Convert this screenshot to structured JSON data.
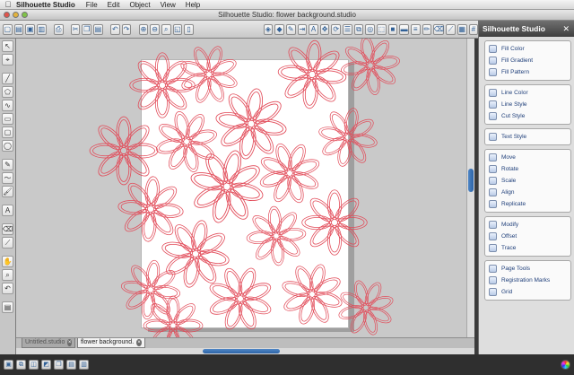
{
  "menubar": {
    "apple_icon": "apple-icon",
    "app": "Silhouette Studio",
    "items": [
      "File",
      "Edit",
      "Object",
      "View",
      "Help"
    ]
  },
  "window": {
    "title": "Silhouette Studio: flower background.studio"
  },
  "toolbar": {
    "icons": [
      "new-document-icon",
      "open-icon",
      "save-icon",
      "library-icon",
      "print-icon",
      "cut-icon",
      "copy-icon",
      "paste-icon",
      "undo-icon",
      "redo-icon",
      "zoom-in-icon",
      "zoom-out-icon",
      "zoom-box-icon",
      "zoom-fit-icon",
      "page-icon"
    ]
  },
  "panel": {
    "title": "Silhouette Studio",
    "close": "✕",
    "groups": [
      {
        "items": [
          "Fill Color",
          "Fill Gradient",
          "Fill Pattern"
        ]
      },
      {
        "items": [
          "Line Color",
          "Line Style",
          "Cut Style"
        ]
      },
      {
        "items": [
          "Text Style"
        ]
      },
      {
        "items": [
          "Move",
          "Rotate",
          "Scale",
          "Align",
          "Replicate"
        ]
      },
      {
        "items": [
          "Modify",
          "Offset",
          "Trace"
        ]
      },
      {
        "items": [
          "Page Tools",
          "Registration Marks",
          "Grid"
        ]
      }
    ]
  },
  "tabs": [
    {
      "label": "Untitled.studio",
      "active": false
    },
    {
      "label": "flower background.studio",
      "active": true
    }
  ],
  "colors": {
    "accent": "#2c63a6",
    "cut_line": "#e24a58",
    "canvas": "#c9c9c9"
  }
}
